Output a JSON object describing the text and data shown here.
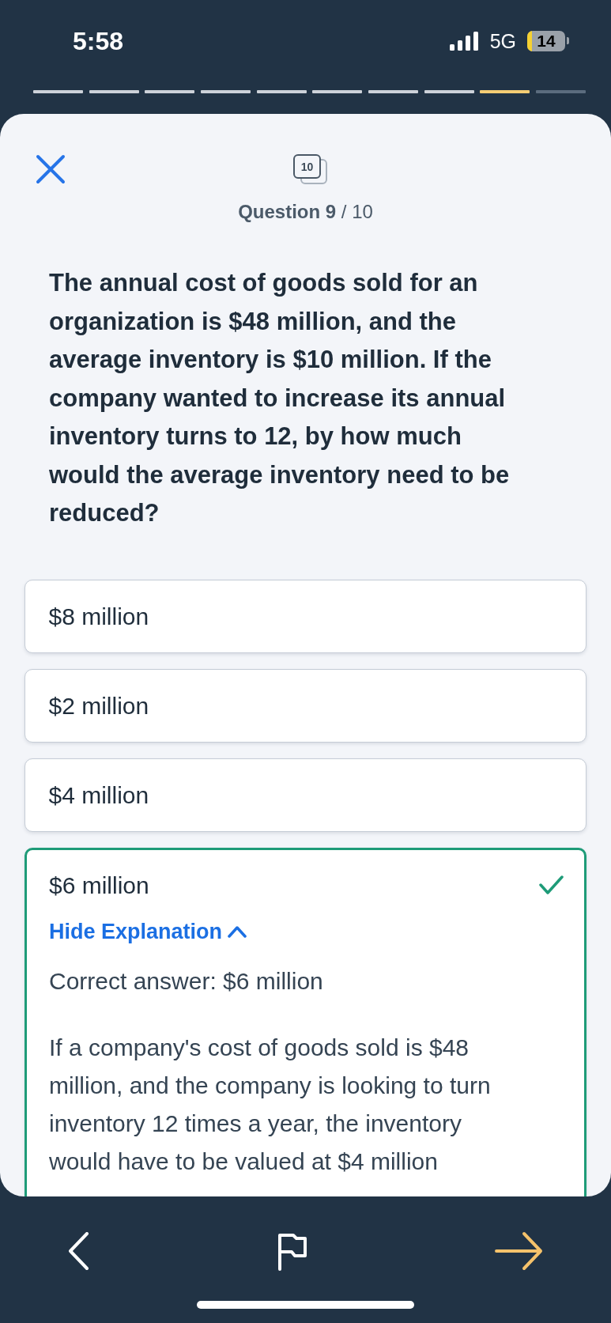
{
  "status_bar": {
    "time": "5:58",
    "network": "5G",
    "battery": "14"
  },
  "progress_segments": [
    {
      "answered": true,
      "selected": false
    },
    {
      "answered": true,
      "selected": false
    },
    {
      "answered": true,
      "selected": false
    },
    {
      "answered": true,
      "selected": false
    },
    {
      "answered": true,
      "selected": false
    },
    {
      "answered": true,
      "selected": false
    },
    {
      "answered": true,
      "selected": false
    },
    {
      "answered": true,
      "selected": false
    },
    {
      "answered": true,
      "selected": true
    },
    {
      "answered": false,
      "selected": false
    }
  ],
  "header": {
    "card_count": "10",
    "question_label": "**Question 9** / 10"
  },
  "question": "The annual cost of goods sold for an organization is $48 million, and the average inventory is $10 million. If the company wanted to increase its annual inventory turns to 12, by how much would the average inventory need to be reduced?",
  "options": [
    {
      "text": "$8 million",
      "selected": false
    },
    {
      "text": "$2 million",
      "selected": false
    },
    {
      "text": "$4 million",
      "selected": false
    },
    {
      "text": "$6 million",
      "selected": true,
      "explanation": {
        "toggle": "Hide Explanation",
        "expanded": true,
        "correct_answer": "Correct answer: $6 million",
        "text": "If a company's cost of goods sold is $48 million, and the company is looking to turn inventory 12 times a year, the inventory would have to be valued at $4 million"
      }
    }
  ]
}
